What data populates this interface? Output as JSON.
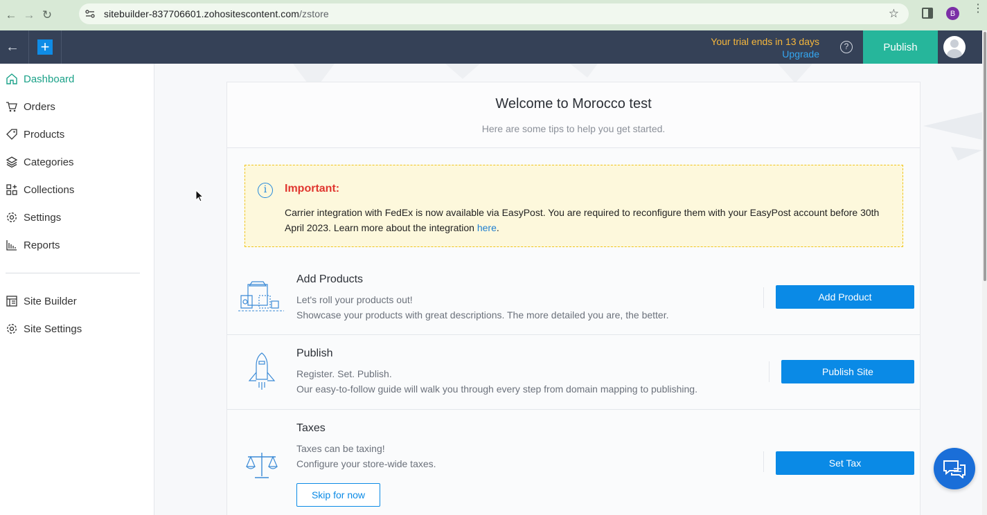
{
  "browser": {
    "url_host": "sitebuilder-837706601.zohositescontent.com",
    "url_path": "/zstore",
    "profile_initial": "B"
  },
  "header": {
    "trial_text": "Your trial ends in 13 days",
    "upgrade_label": "Upgrade",
    "help_glyph": "?",
    "publish_label": "Publish"
  },
  "sidebar": {
    "items": [
      {
        "label": "Dashboard",
        "icon": "home-icon",
        "active": true
      },
      {
        "label": "Orders",
        "icon": "cart-icon"
      },
      {
        "label": "Products",
        "icon": "tag-icon"
      },
      {
        "label": "Categories",
        "icon": "layers-icon"
      },
      {
        "label": "Collections",
        "icon": "grid-plus-icon"
      },
      {
        "label": "Settings",
        "icon": "gear-icon"
      },
      {
        "label": "Reports",
        "icon": "bar-chart-icon"
      }
    ],
    "secondary": [
      {
        "label": "Site Builder",
        "icon": "site-builder-icon"
      },
      {
        "label": "Site Settings",
        "icon": "gear-icon"
      }
    ]
  },
  "welcome": {
    "title": "Welcome to Morocco test",
    "subtitle": "Here are some tips to help you get started."
  },
  "notice": {
    "title": "Important:",
    "body": "Carrier integration with FedEx is now available via EasyPost. You are required to reconfigure them with your EasyPost account before 30th April 2023. Learn more about the integration ",
    "link": "here",
    "tail": "."
  },
  "steps": [
    {
      "title": "Add Products",
      "line1": "Let's roll your products out!",
      "line2": "Showcase your products with great descriptions. The more detailed you are, the better.",
      "button": "Add Product"
    },
    {
      "title": "Publish",
      "line1": "Register. Set. Publish.",
      "line2": "Our easy-to-follow guide will walk you through every step from domain mapping to publishing.",
      "button": "Publish Site"
    },
    {
      "title": "Taxes",
      "line1": "Taxes can be taxing!",
      "line2": "Configure your store-wide taxes.",
      "button": "Set Tax",
      "secondary_button": "Skip for now"
    }
  ],
  "colors": {
    "accent_green": "#26b69b",
    "primary_blue": "#0a8ae6",
    "header_bg": "#354157",
    "warning_red": "#e0362f"
  }
}
